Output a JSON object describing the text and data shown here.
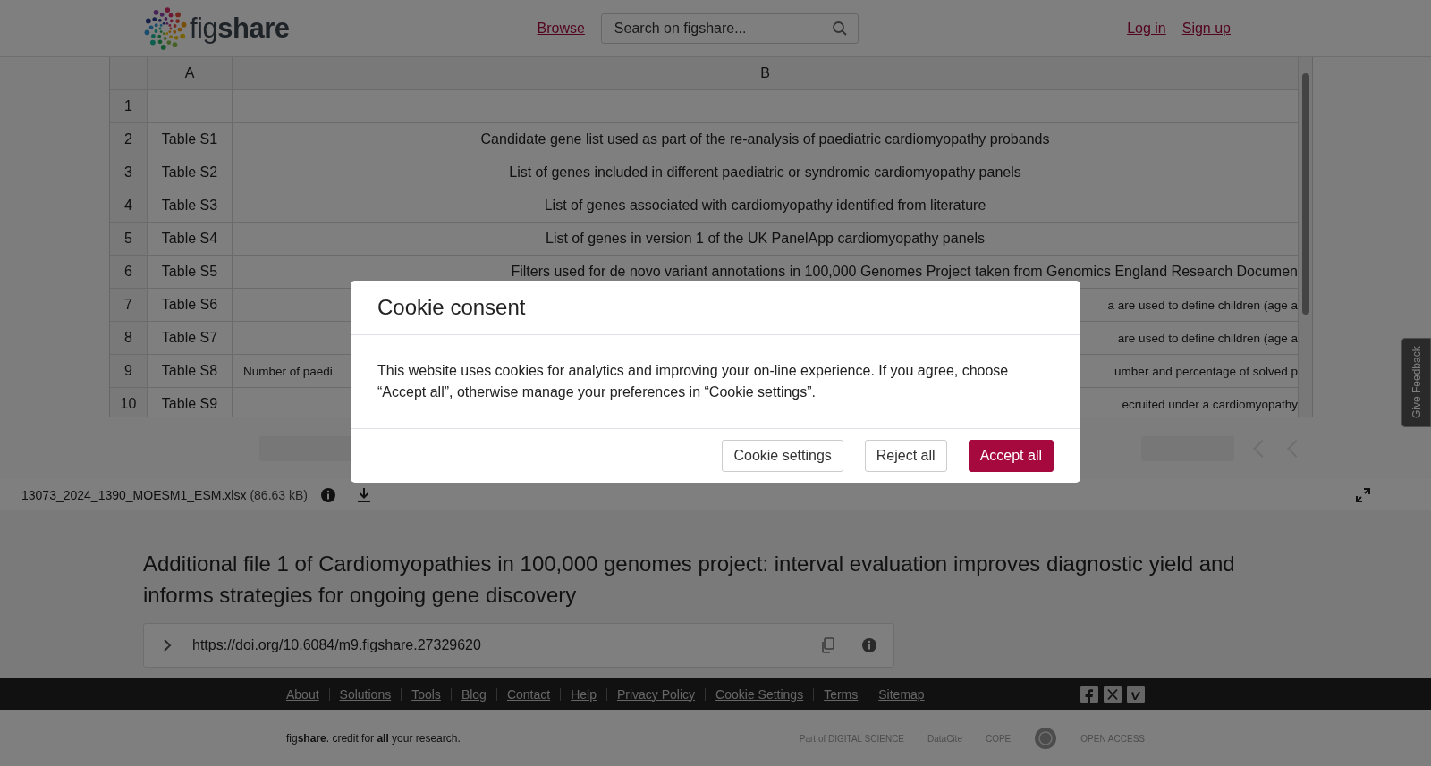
{
  "header": {
    "logo": "fig**share**",
    "browse": "Browse",
    "search": {
      "placeholder": "Search on figshare..."
    },
    "login": "Log in",
    "signup": "Sign up"
  },
  "spreadsheet": {
    "columns": [
      "A",
      "B"
    ],
    "rows": [
      {
        "number": "1",
        "a": "",
        "b": ""
      },
      {
        "number": "2",
        "a": "Table S1",
        "b": "Candidate gene list used as part of the re-analysis of paediatric cardiomyopathy probands"
      },
      {
        "number": "3",
        "a": "Table S2",
        "b": "List of genes included in different paediatric or syndromic cardiomyopathy panels"
      },
      {
        "number": "4",
        "a": "Table S3",
        "b": "List of genes associated with cardiomyopathy identified from literature"
      },
      {
        "number": "5",
        "a": "Table S4",
        "b": "List of genes in version 1 of the UK PanelApp cardiomyopathy panels"
      },
      {
        "number": "6",
        "a": "Table S5",
        "b": "Filters used for de novo variant annotations in 100,000 Genomes Project taken from Genomics England Research Documen"
      },
      {
        "number": "7",
        "a": "Table S6",
        "b_right": "a are used to define children (age a"
      },
      {
        "number": "8",
        "a": "Table S7",
        "b_right": "are used to define children (age a"
      },
      {
        "number": "9",
        "a": "Table S8",
        "b_left": "Number of paedi",
        "b_right": "umber and percentage of solved p"
      },
      {
        "number": "10",
        "a": "Table S9",
        "b_right": "ecruited under a cardiomyopathy"
      }
    ]
  },
  "file_bar": {
    "name": "13073_2024_1390_MOESM1_ESM.xlsx",
    "size": "(86.63 kB)"
  },
  "article": {
    "title": "Additional file 1 of Cardiomyopathies in 100,000 genomes project: interval evaluation improves diagnostic yield and informs strategies for ongoing gene discovery",
    "doi": "https://doi.org/10.6084/m9.figshare.27329620"
  },
  "footer": {
    "links": [
      "About",
      "Solutions",
      "Tools",
      "Blog",
      "Contact",
      "Help",
      "Privacy Policy",
      "Cookie Settings",
      "Terms",
      "Sitemap"
    ],
    "tagline": "fig**share**. credit for **all** your research.",
    "partners": [
      {
        "kind": "text",
        "label": "Part of DIGITAL SCIENCE"
      },
      {
        "kind": "text",
        "label": "DataCite"
      },
      {
        "kind": "text",
        "label": "COPE"
      },
      {
        "kind": "seal"
      },
      {
        "kind": "text",
        "label": "OPEN ACCESS"
      }
    ]
  },
  "feedback_tab": "Give Feedback",
  "cookie_dialog": {
    "title": "Cookie consent",
    "text": "This website uses cookies for analytics and improving your on-line experience. If you agree, choose “Accept all”, otherwise manage your preferences in “Cookie settings”.",
    "buttons": [
      {
        "label": "Cookie settings",
        "kind": "secondary"
      },
      {
        "label": "Reject all",
        "kind": "secondary"
      },
      {
        "label": "Accept all",
        "kind": "primary"
      }
    ]
  }
}
